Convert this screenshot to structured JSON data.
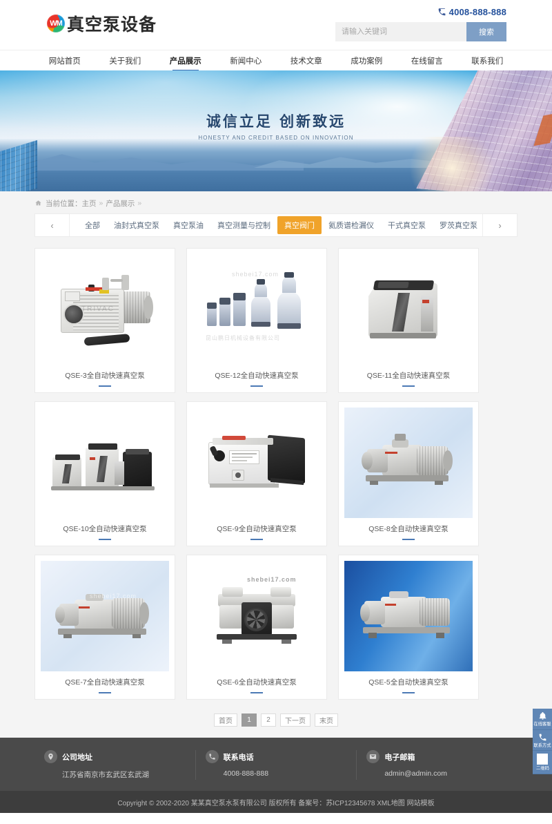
{
  "header": {
    "logo_text": "真空泵设备",
    "logo_mark": "wm-logo-icon",
    "phone": "4008-888-888",
    "search_placeholder": "请输入关键词",
    "search_value": "",
    "search_button": "搜索"
  },
  "nav": {
    "items": [
      {
        "label": "网站首页",
        "active": false
      },
      {
        "label": "关于我们",
        "active": false
      },
      {
        "label": "产品展示",
        "active": true
      },
      {
        "label": "新闻中心",
        "active": false
      },
      {
        "label": "技术文章",
        "active": false
      },
      {
        "label": "成功案例",
        "active": false
      },
      {
        "label": "在线留言",
        "active": false
      },
      {
        "label": "联系我们",
        "active": false
      }
    ]
  },
  "banner": {
    "title": "诚信立足  创新致远",
    "subtitle": "HONESTY AND CREDIT BASED ON INNOVATION"
  },
  "breadcrumb": {
    "label": "当前位置：",
    "home": "主页",
    "current": "产品展示",
    "sep": "»"
  },
  "categories": {
    "prev": "‹",
    "next": "›",
    "items": [
      {
        "label": "全部",
        "active": false
      },
      {
        "label": "油封式真空泵",
        "active": false
      },
      {
        "label": "真空泵油",
        "active": false
      },
      {
        "label": "真空测量与控制",
        "active": false
      },
      {
        "label": "真空阀门",
        "active": true
      },
      {
        "label": "氦质谱检漏仪",
        "active": false
      },
      {
        "label": "干式真空泵",
        "active": false
      },
      {
        "label": "罗茨真空泵",
        "active": false
      }
    ]
  },
  "products": [
    {
      "title": "QSE-3全自动快速真空泵",
      "art": "rotary-vane-pump"
    },
    {
      "title": "QSE-12全自动快速真空泵",
      "art": "filter-series"
    },
    {
      "title": "QSE-11全自动快速真空泵",
      "art": "dry-pump-cabinet"
    },
    {
      "title": "QSE-10全自动快速真空泵",
      "art": "cabinet-group"
    },
    {
      "title": "QSE-9全自动快速真空泵",
      "art": "screw-pump"
    },
    {
      "title": "QSE-8全自动快速真空泵",
      "art": "roots-blower"
    },
    {
      "title": "QSE-7全自动快速真空泵",
      "art": "roots-blower-2"
    },
    {
      "title": "QSE-6全自动快速真空泵",
      "art": "piston-compressor"
    },
    {
      "title": "QSE-5全自动快速真空泵",
      "art": "roots-unit"
    }
  ],
  "watermarks": {
    "card2_top": "shebei17.com",
    "card2_mid": "昆山鹏日机械设备有限公司",
    "card7": "shebei17.com",
    "card8": "shebei17.com"
  },
  "pagination": {
    "items": [
      {
        "label": "首页",
        "active": false
      },
      {
        "label": "1",
        "active": true
      },
      {
        "label": "2",
        "active": false
      },
      {
        "label": "下一页",
        "active": false
      },
      {
        "label": "末页",
        "active": false
      }
    ]
  },
  "footer": {
    "columns": [
      {
        "icon": "location-pin-icon",
        "title": "公司地址",
        "value": "江苏省南京市玄武区玄武湖"
      },
      {
        "icon": "phone-icon",
        "title": "联系电话",
        "value": "4008-888-888"
      },
      {
        "icon": "envelope-icon",
        "title": "电子邮箱",
        "value": "admin@admin.com"
      }
    ],
    "copyright": "Copyright © 2002-2020 某某真空泵水泵有限公司 版权所有 备案号：苏ICP12345678 XML地图 网站模板"
  },
  "side_panel": {
    "items": [
      {
        "icon": "bell-icon",
        "label": "在线客服"
      },
      {
        "icon": "phone-icon",
        "label": "联系方式"
      },
      {
        "icon": "qrcode-icon",
        "label": "二维码"
      }
    ]
  },
  "colors": {
    "accent_orange": "#f0a32a",
    "nav_active": "#3d6fb4",
    "rule_blue": "#4b79b5",
    "search_btn": "#7e9fc6",
    "footer_bg": "#4a4a4a",
    "copy_bg": "#3d3d3d",
    "side_bg": "#5f86b5",
    "phone_blue": "#23509b"
  }
}
